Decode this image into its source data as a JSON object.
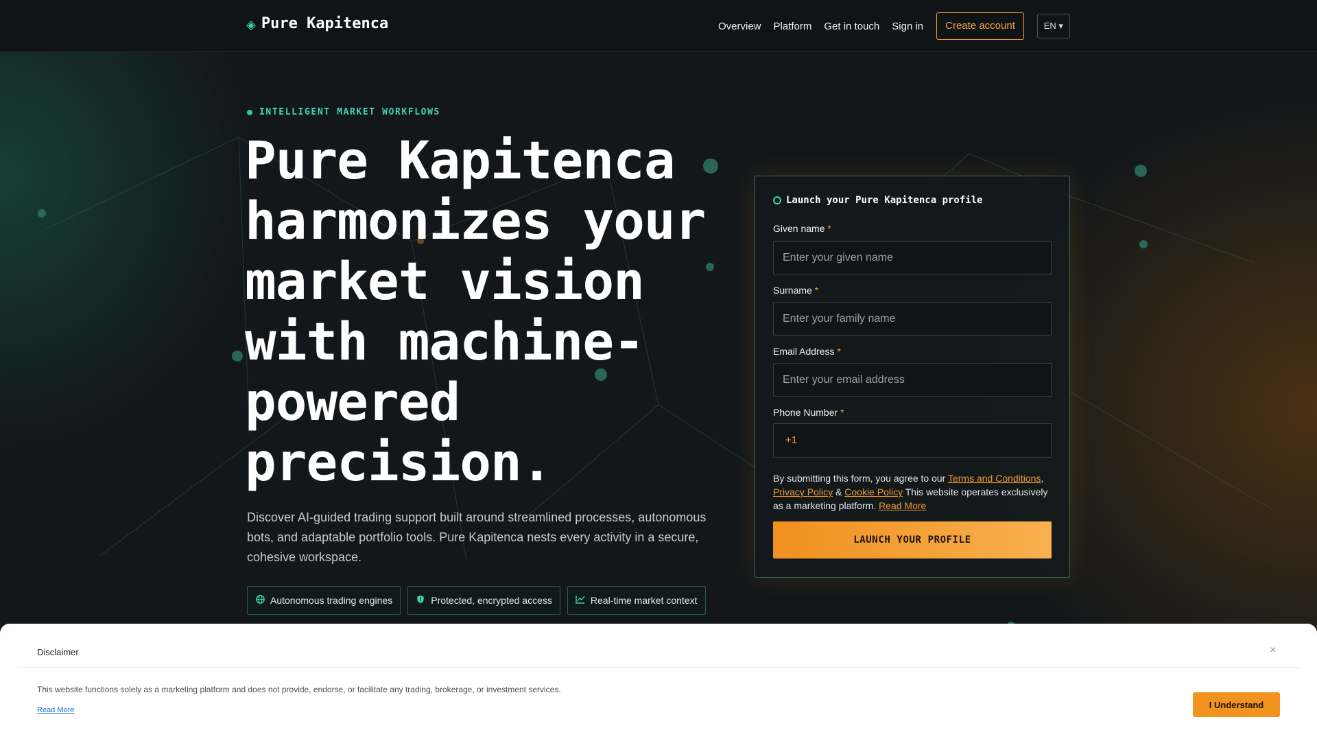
{
  "nav": {
    "brand": "Pure Kapitenca",
    "links": [
      "Overview",
      "Platform",
      "Get in touch",
      "Sign in"
    ],
    "create_account": "Create account",
    "language": "EN ▾"
  },
  "hero": {
    "eyebrow": "INTELLIGENT MARKET WORKFLOWS",
    "headline": "Pure Kapitenca harmonizes your market vision with machine-powered precision.",
    "lead": "Discover AI-guided trading support built around streamlined processes, autonomous bots, and adaptable portfolio tools. Pure Kapitenca nests every activity in a secure, cohesive workspace.",
    "features": [
      {
        "icon": "globe-icon",
        "label": "Autonomous trading engines"
      },
      {
        "icon": "shield-icon",
        "label": "Protected, encrypted access"
      },
      {
        "icon": "chart-line-icon",
        "label": "Real-time market context"
      }
    ]
  },
  "form": {
    "title": "Launch your Pure Kapitenca profile",
    "given_name": {
      "label": "Given name",
      "placeholder": "Enter your given name"
    },
    "surname": {
      "label": "Surname",
      "placeholder": "Enter your family name"
    },
    "email": {
      "label": "Email Address",
      "placeholder": "Enter your email address"
    },
    "phone": {
      "label": "Phone Number",
      "code": "+1",
      "value": ""
    },
    "required_mark": "*",
    "consent": {
      "prefix": "By submitting this form, you agree to our ",
      "terms": "Terms and Conditions",
      "comma": ",",
      "privacy": "Privacy Policy",
      "amp": " & ",
      "cookie": "Cookie Policy",
      "suffix": " This website operates exclusively as a marketing platform. ",
      "read_more": "Read More"
    },
    "submit": "LAUNCH YOUR PROFILE"
  },
  "disclaimer": {
    "title": "Disclaimer",
    "close": "×",
    "text": "This website functions solely as a marketing platform and does not provide, endorse, or facilitate any trading, brokerage, or investment services.",
    "read_more": "Read More",
    "button": "I Understand"
  },
  "colors": {
    "accent_teal": "#3fd3b0",
    "accent_orange": "#f29a35",
    "background": "#121619"
  }
}
